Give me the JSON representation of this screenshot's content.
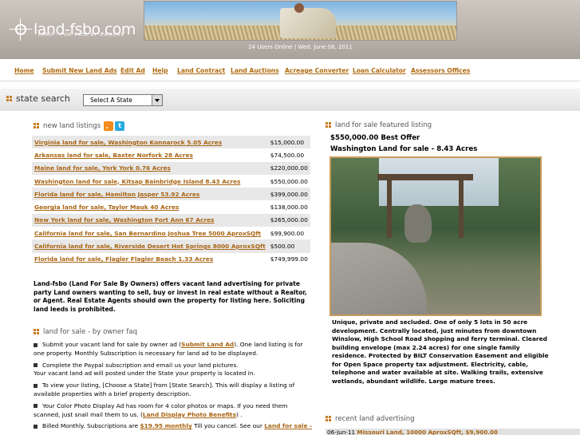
{
  "header": {
    "logo_text": "land-fsbo.com",
    "logo_sub": "LAND - FOR SALE BY OWNERS",
    "status_text": "24 Users Online | Wed. June 08, 2011"
  },
  "nav": [
    {
      "label": "Home"
    },
    {
      "label": "Submit New Land Ads"
    },
    {
      "label": "Edit Ad"
    },
    {
      "label": "Help"
    },
    {
      "label": "Land Contract"
    },
    {
      "label": "Land Auctions"
    },
    {
      "label": "Acreage Converter"
    },
    {
      "label": "Loan Calculator"
    },
    {
      "label": "Assessors Offices"
    }
  ],
  "state_search": {
    "title": "state search",
    "select_value": "Select A State"
  },
  "listings": {
    "title": "new land listings",
    "rows": [
      {
        "title": "Virginia land for sale, Washington Konnarock 5.05 Acres",
        "price": "$15,000.00"
      },
      {
        "title": "Arkansas land for sale, Baxter Norfork 28 Acres",
        "price": "$74,500.00"
      },
      {
        "title": "Maine land for sale, York York 0.76 Acres",
        "price": "$220,000.00"
      },
      {
        "title": "Washington land for sale, Kitsap Bainbridge Island 8.43 Acres",
        "price": "$550,000.00"
      },
      {
        "title": "Florida land for sale, Hamilton Jasper 53.92 Acres",
        "price": "$399,000.00"
      },
      {
        "title": "Georgia land for sale, Taylor Mauk 40 Acres",
        "price": "$138,000.00"
      },
      {
        "title": "New York land for sale, Washington Fort Ann 67 Acres",
        "price": "$265,000.00"
      },
      {
        "title": "California land for sale, San Bernardino Joshua Tree 5000 AproxSQft",
        "price": "$99,900.00"
      },
      {
        "title": "California land for sale, Riverside Desert Hot Springs 8000 AproxSQft",
        "price": "$500.00"
      },
      {
        "title": "Florida land for sale, Flagler Flagler Beach 1.33 Acres",
        "price": "$749,999.00"
      }
    ]
  },
  "intro": "Land-fsbo (Land For Sale By Owners) offers vacant land advertising for private party Land owners wanting to sell, buy or invest in real estate without a Realtor, or Agent. Real Estate Agents should own the property for listing here. Soliciting land leeds is prohibited.",
  "faq": {
    "title": "land for sale - by owner faq",
    "item1_a": "Submit your vacant land for sale by owner ad (",
    "item1_link": "Submit Land Ad",
    "item1_b": "). One land listing is for one property. Monthly Subscription is necessary for land ad to be displayed.",
    "item2_a": "Complete the Paypal subscription and email us your land pictures.",
    "item2_b": "Your vacant land ad will posted under the State your property is located in.",
    "item3": "To view your listing, [Choose a State] from [State Search]. This will display a listing of available properties with a brief property description.",
    "item4_a": "Your Color Photo Display Ad has room for 4 color photos or maps. If you need them scanned, just snail mail them to us. (",
    "item4_link": "Land Display Photo Benefits",
    "item4_b": ") .",
    "item5_a": "Billed Monthly. Subscriptions are ",
    "item5_link1": "$19.95 monthly",
    "item5_b": " Till you cancel. See our ",
    "item5_link2": "Land for sale -"
  },
  "featured": {
    "title": "land for sale featured listing",
    "price_line": "$550,000.00 Best Offer",
    "property_title": "Washington Land for sale - 8.43 Acres",
    "description": "Unique, private and secluded. One of only 5 lots in 50 acre development. Centrally located, just minutes from downtown Winslow, High School Road shopping and ferry terminal. Cleared building envelope (max 2.24 acres) for one single family residence. Protected by BILT Conservation Easement and eligible for Open Space property tax adjustment. Electricity, cable, telephone and water available at site. Walking trails, extensive wetlands, abundant wildlife. Large mature trees."
  },
  "recent": {
    "title": "recent land advertising",
    "date": "06-Jun-11",
    "link": "Missouri Land, 10000 AproxSQft, $9,900.00"
  }
}
